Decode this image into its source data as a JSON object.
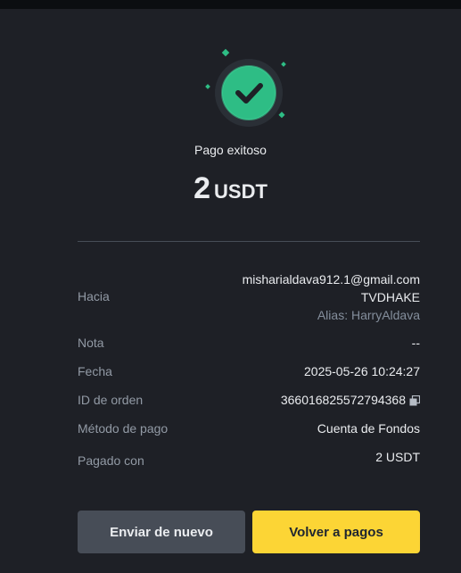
{
  "result": {
    "title": "Pago exitoso",
    "amount": "2",
    "currency": "USDT"
  },
  "details": {
    "to_label": "Hacia",
    "to_email": "misharialdava912.1@gmail.com",
    "to_name": "TVDHAKE",
    "to_alias": "Alias: HarryAldava",
    "note_label": "Nota",
    "note_value": "--",
    "date_label": "Fecha",
    "date_value": "2025-05-26 10:24:27",
    "order_label": "ID de orden",
    "order_value": "366016825572794368",
    "method_label": "Método de pago",
    "method_value": "Cuenta de Fondos",
    "paid_label": "Pagado con",
    "paid_value": "2 USDT"
  },
  "actions": {
    "send_again": "Enviar de nuevo",
    "back_to_payments": "Volver a pagos"
  },
  "colors": {
    "background": "#1e2026",
    "success": "#2ebd85",
    "primary_button": "#fcd535",
    "secondary_button": "#474d57"
  },
  "icons": {
    "success": "check-circle-icon",
    "copy": "copy-icon"
  }
}
